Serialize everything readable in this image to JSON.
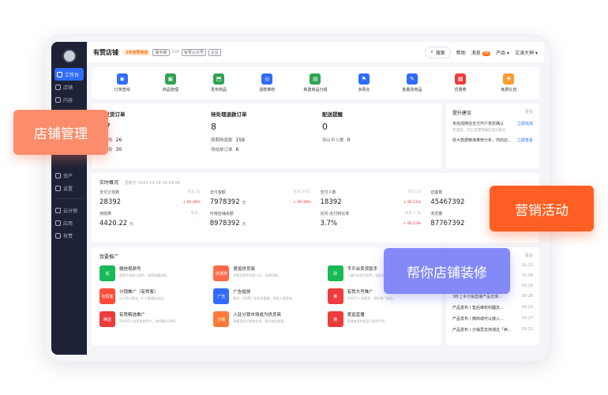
{
  "sidebar": {
    "items": [
      {
        "label": "工作台",
        "active": true
      },
      {
        "label": "店铺"
      },
      {
        "label": "内容"
      },
      {
        "label": "商品"
      },
      {
        "label": "资产"
      },
      {
        "label": "设置"
      },
      {
        "label": "云分销"
      },
      {
        "label": "应用"
      },
      {
        "label": "有赞"
      }
    ]
  },
  "header": {
    "shop_name": "有赞店铺",
    "tag_years": "2年有赞老店",
    "tag_service": "服务期",
    "tag_ssp": "SSP",
    "tag_public": "有赞公众号",
    "tag_enterprise": "企业",
    "search": "搜索",
    "help": "帮助",
    "messages": "消息",
    "messages_count": "34",
    "products": "产品",
    "user": "文涛大神"
  },
  "quick_actions": [
    {
      "label": "订单查询",
      "color": "#2f6bff"
    },
    {
      "label": "商品管理",
      "color": "#2ea44f"
    },
    {
      "label": "发布商品",
      "color": "#2ea44f"
    },
    {
      "label": "退款维权",
      "color": "#2f6bff"
    },
    {
      "label": "新建商品分组",
      "color": "#2ea44f"
    },
    {
      "label": "多网点",
      "color": "#2f6bff"
    },
    {
      "label": "批量改商品",
      "color": "#2f6bff"
    },
    {
      "label": "优惠券",
      "color": "#ee3b3b"
    },
    {
      "label": "免费礼包",
      "color": "#ff9a2e"
    }
  ],
  "todo": [
    {
      "title": "待发货订单",
      "value": "97",
      "lines": [
        {
          "label": "周期购",
          "value": "26"
        },
        {
          "label": "待付款",
          "value": "30"
        }
      ]
    },
    {
      "title": "待处理退款订单",
      "value": "8",
      "lines": [
        {
          "label": "周期购退款",
          "value": "159"
        },
        {
          "label": "待结单订单",
          "value": "6"
        }
      ]
    },
    {
      "title": "配送提醒",
      "value": "0",
      "lines": [
        {
          "label": "待认中入数",
          "value": "0"
        }
      ]
    }
  ],
  "advice": {
    "title": "提升建议",
    "more": "更多",
    "items": [
      {
        "text": "未完成微信支付开户意愿确认",
        "sub": "完成后，可正常使用微信支付能力",
        "action": "立即完成"
      },
      {
        "text": "经大数据精准推荐分析，你的店...",
        "sub": "",
        "action": "立即查看"
      }
    ]
  },
  "realtime": {
    "title": "实时概况",
    "updated": "更新于 2022-10-18 16:19:08",
    "metrics": [
      {
        "label": "支付订单数",
        "yest": "昨日 16",
        "value": "28392",
        "unit": "",
        "delta": "↓ 80.38%"
      },
      {
        "label": "支付金额",
        "yest": "昨日 3787",
        "value": "7978392",
        "unit": "元",
        "delta": "↓ 99.38%"
      },
      {
        "label": "支付人数",
        "yest": "昨日 10",
        "value": "18392",
        "unit": "",
        "delta": "↓ 90.21%"
      },
      {
        "label": "访客数",
        "yest": "",
        "value": "45467392",
        "unit": "",
        "delta": ""
      },
      {
        "label": "待结算",
        "yest": "昨日 -",
        "value": "4420.22",
        "unit": "元",
        "delta": "-"
      },
      {
        "label": "可用店铺余额",
        "yest": "",
        "value": "8978392",
        "unit": "元",
        "delta": ""
      },
      {
        "label": "访问-支付转化率",
        "yest": "昨日 7.36",
        "value": "3.7%",
        "unit": "",
        "delta": "↓ 60.23%"
      },
      {
        "label": "浏览量",
        "yest": "",
        "value": "87767392",
        "unit": "",
        "delta": ""
      }
    ]
  },
  "promo": {
    "title": "我要推广",
    "items": [
      {
        "title": "微信视频号",
        "desc": "视频号关联小程序，获得海量流量。",
        "color": "#19b955",
        "icon": "视"
      },
      {
        "title": "爱逛供货商",
        "desc": "特惠货源供货商入驻，货源好物。",
        "color": "#ff6b4a",
        "icon": "供货商"
      },
      {
        "title": "手平台卖货助手",
        "desc": "一键开启卖货助手，轻松管理店铺。",
        "color": "#19b955",
        "icon": "助"
      },
      {
        "title": "分销推广（有赞客）",
        "desc": "让分享付佣金，扩大客源促成交。",
        "color": "#ff4d3a",
        "icon": "有赞客"
      },
      {
        "title": "广告投放",
        "desc": "微信、QQ等广告投放渠道，精准人群投放。",
        "color": "#2f6bff",
        "icon": "广告"
      },
      {
        "title": "有赞大号推广",
        "desc": "5000万+流量池，帮你推广商品。",
        "color": "#ee3b3b",
        "icon": "推"
      },
      {
        "title": "有赞精选推广",
        "desc": "5000万+优质电商用户，持续曝光GMV。",
        "color": "#ee3b3b",
        "icon": "精选"
      },
      {
        "title": "入驻分销市场成为供货商",
        "desc": "海量优质分销商合作，提升商品销量。",
        "color": "#ff7a3a",
        "icon": "分销"
      },
      {
        "title": "爱逛直播",
        "desc": "直播变现的爱逛小程序平台",
        "color": "#ee3b3b",
        "icon": "播"
      }
    ]
  },
  "news": {
    "more": "更多",
    "items": [
      {
        "text": "",
        "date": "10.13"
      },
      {
        "text": "",
        "date": "10.06"
      },
      {
        "text": "",
        "date": "09.28"
      },
      {
        "text": "3秒上手分销直播产品支撑...",
        "date": "09.28"
      },
      {
        "text": "产品发布丨售后维权利器支...",
        "date": "09.23"
      },
      {
        "text": "产品发布丨微商城可以接入...",
        "date": "09.27"
      },
      {
        "text": "产品发布丨分销员支持通过「卖...",
        "date": "09.23"
      }
    ]
  },
  "overlays": {
    "store_management": "店铺管理",
    "marketing": "营销活动",
    "decoration": "帮你店铺装修"
  }
}
